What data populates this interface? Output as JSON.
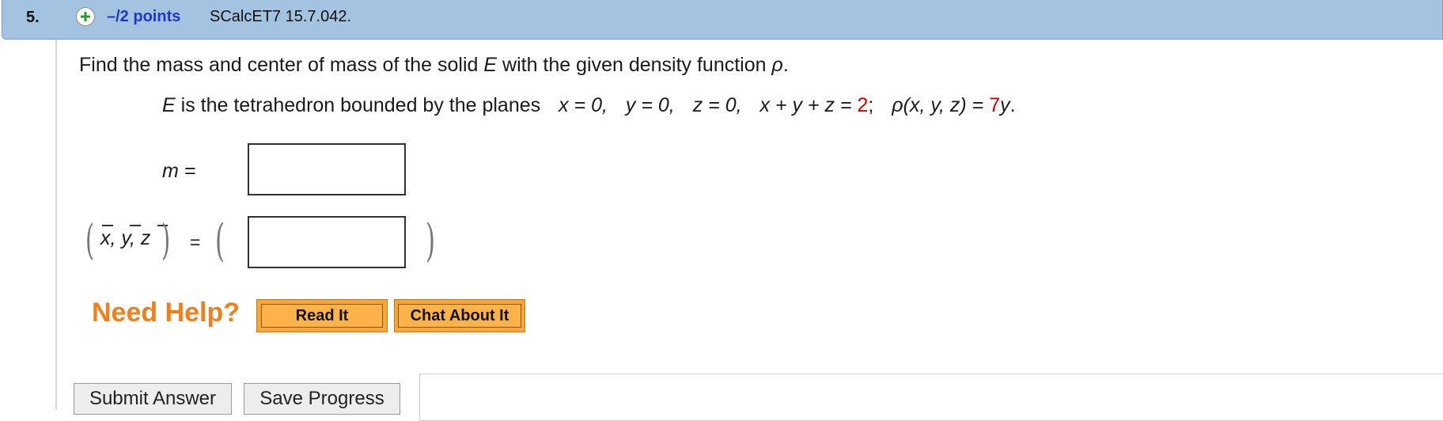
{
  "header": {
    "number": "5.",
    "points": "–/2 points",
    "assignment": "SCalcET7 15.7.042.",
    "expand_icon": "plus-circle-icon"
  },
  "question": {
    "prompt_text": "Find the mass and center of mass of the solid",
    "prompt_var": "E",
    "prompt_text2": "with the given density function",
    "prompt_rho": "ρ",
    "prompt_end": ".",
    "given_E": "E",
    "given_text": "is the tetrahedron bounded by the planes",
    "given_x": "x = 0,",
    "given_y": "y = 0,",
    "given_z": "z = 0,",
    "given_plane": "x + y + z =",
    "given_plane_value": "2",
    "given_semicolon": ";",
    "given_rho": "ρ(x, y, z) =",
    "given_rho_coef": "7",
    "given_rho_var": "y",
    "given_end": "."
  },
  "answers": {
    "mass_label": "m =",
    "mass_value": "",
    "center_label": "x, y, z",
    "center_eq": "=",
    "center_value": ""
  },
  "help": {
    "label": "Need Help?",
    "read_it": "Read It",
    "chat_about_it": "Chat About It"
  },
  "actions": {
    "submit": "Submit Answer",
    "save": "Save Progress"
  },
  "colors": {
    "header_bg": "#a4c3e1",
    "points": "#1f36c6",
    "highlight_red": "#d40000",
    "need_help": "#f07f1d",
    "help_button": "#f6a73b"
  }
}
